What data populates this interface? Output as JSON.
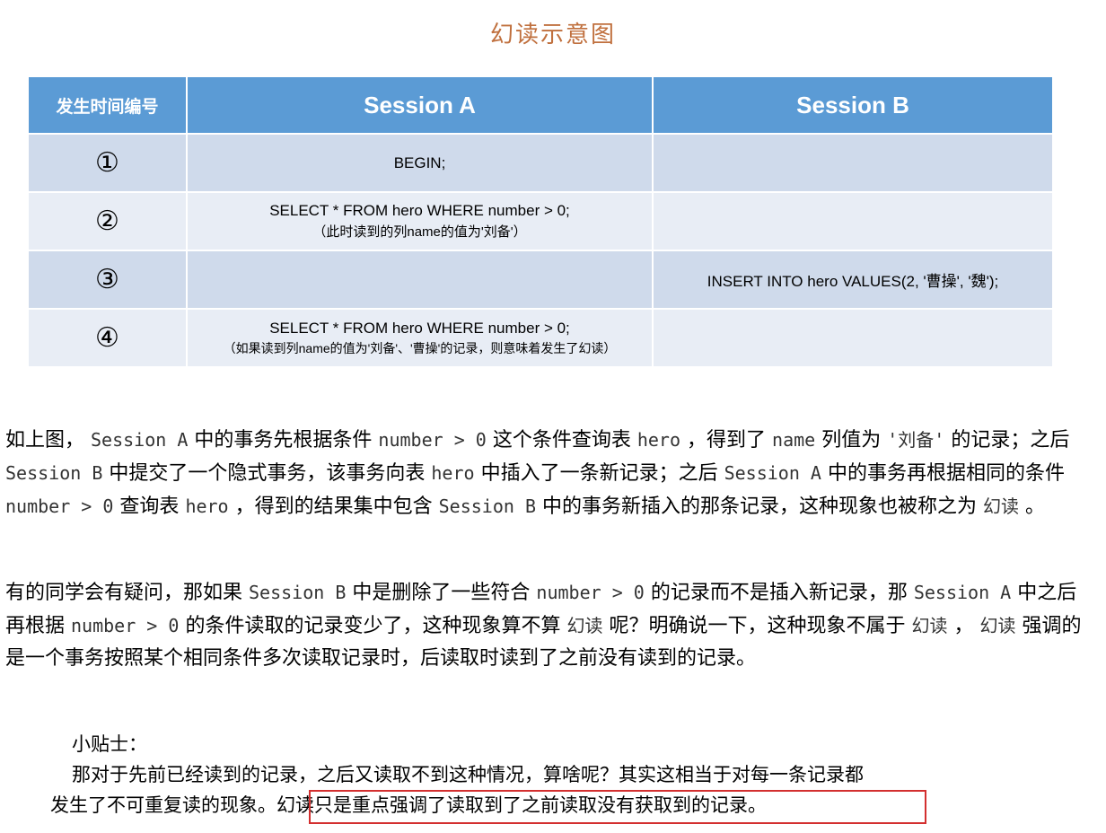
{
  "figure_title": "幻读示意图",
  "table": {
    "headers": [
      "发生时间编号",
      "Session A",
      "Session B"
    ],
    "rows": [
      {
        "num": "①",
        "a_main": "BEGIN;",
        "a_note": "",
        "b": ""
      },
      {
        "num": "②",
        "a_main": "SELECT * FROM hero WHERE number > 0;",
        "a_note": "（此时读到的列name的值为'刘备'）",
        "b": ""
      },
      {
        "num": "③",
        "a_main": "",
        "a_note": "",
        "b": "INSERT INTO hero VALUES(2, '曹操', '魏');"
      },
      {
        "num": "④",
        "a_main": "SELECT * FROM hero WHERE number > 0;",
        "a_note": "（如果读到列name的值为'刘备'、'曹操'的记录，则意味着发生了幻读）",
        "b": ""
      }
    ]
  },
  "para1": {
    "t1": "如上图，",
    "c1": "Session A",
    "t2": "中的事务先根据条件",
    "c2": "number > 0",
    "t3": "这个条件查询表",
    "c3": "hero",
    "t4": "，得到了",
    "c4": "name",
    "t5": "列值为",
    "c5": "'刘备'",
    "t6": "的记录；之后",
    "c6": "Session B",
    "t7": "中提交了一个隐式事务，该事务向表",
    "c7": "hero",
    "t8": "中插入了一条新记录；之后",
    "c8": "Session A",
    "t9": "中的事务再根据相同的条件",
    "c9": "number > 0",
    "t10": "查询表",
    "c10": "hero",
    "t11": "，得到的结果集中包含",
    "c11": "Session B",
    "t12": "中的事务新插入的那条记录，这种现象也被称之为",
    "c12": "幻读",
    "t13": "。"
  },
  "para2": {
    "t1": "有的同学会有疑问，那如果",
    "c1": "Session B",
    "t2": "中是删除了一些符合",
    "c2": "number > 0",
    "t3": "的记录而不是插入新记录，那",
    "c3": "Session A",
    "t4": "中之后再根据",
    "c4": "number > 0",
    "t5": "的条件读取的记录变少了，这种现象算不算",
    "c5": "幻读",
    "t6": "呢？明确说一下，这种现象不属于",
    "c6": "幻读",
    "t7": "，",
    "c7": "幻读",
    "t8": "强调的是一个事务按照某个相同条件多次读取记录时，后读取时读到了之前没有读到的记录。"
  },
  "tip": {
    "label": "小贴士：",
    "line1": "那对于先前已经读到的记录，之后又读取不到这种情况，算啥呢？其实这相当于对每一条记录都",
    "line2a": "发生了不可重复读的现象。",
    "line2b": "幻读只是重点强调了读取到了之前读取没有获取到的记录。"
  }
}
